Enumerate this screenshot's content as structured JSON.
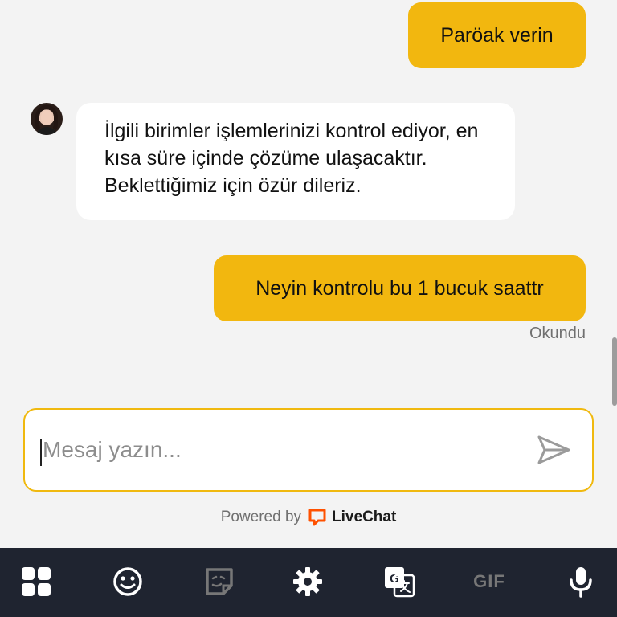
{
  "messages": [
    {
      "direction": "out",
      "text": "Paröak verin"
    },
    {
      "direction": "in",
      "text": "İlgili birimler işlemlerinizi kontrol ediyor, en kısa süre içinde çözüme ulaşacaktır. Beklettiğimiz için özür dileriz."
    },
    {
      "direction": "out",
      "text": "Neyin kontrolu bu 1 bucuk saattr",
      "status": "Okundu"
    }
  ],
  "composer": {
    "placeholder": "Mesaj yazın..."
  },
  "footer": {
    "powered_by": "Powered by",
    "brand": "LiveChat"
  },
  "keyboard_toolbar": {
    "items": [
      "apps",
      "emoji",
      "sticker",
      "settings",
      "translate",
      "GIF",
      "microphone"
    ]
  },
  "colors": {
    "accent": "#f2b70f",
    "background": "#f3f3f3",
    "toolbar": "#1f2430",
    "brand": "#ff5100"
  }
}
